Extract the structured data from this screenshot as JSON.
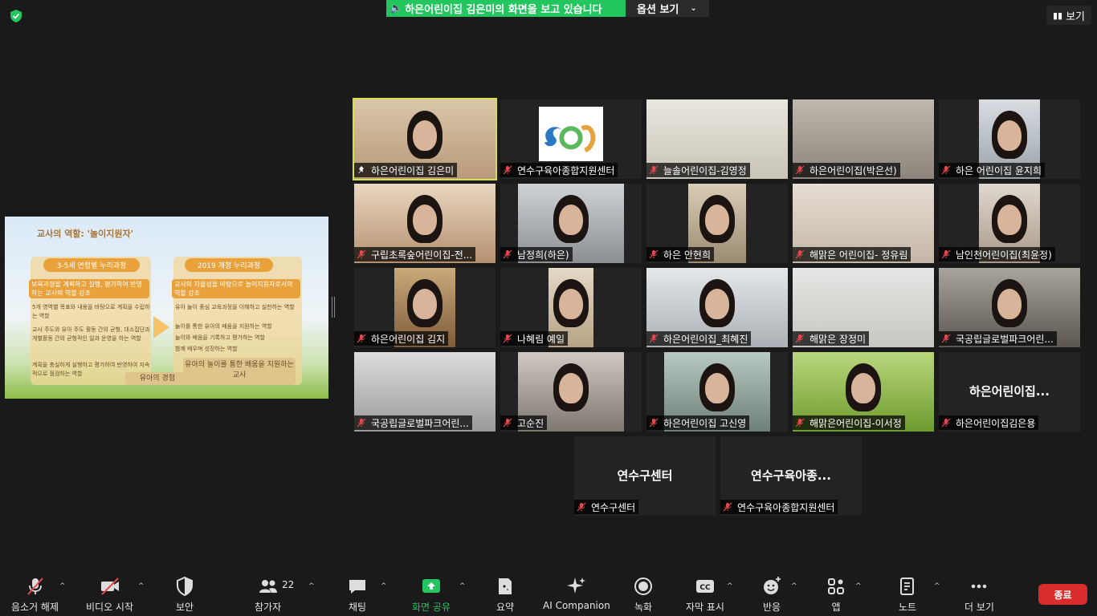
{
  "banner": {
    "sharing_text": "하은어린이집 김은미의 화면을 보고 있습니다",
    "view_options_label": "옵션 보기",
    "view_button_label": "보기"
  },
  "shared_screen": {
    "slide_title": "교사의 역할: '놀이지원자'",
    "left_header": "3-5세 연령별 누리과정",
    "right_header": "2019 개정 누리과정",
    "left_sub": "보육과정을 계획하고 실행, 평가하여 반영하는 교사의 역할 강조",
    "right_sub": "교사의 자율성을 바탕으로 놀이지원자로서의 역할 강조",
    "left_points": [
      "5개 영역별 목표와 내용을 바탕으로 계획을 수립하는 역할",
      "교사 주도와 유아 주도 활동 간의 균형, 대소집단과 개별활동 간의 균형적인 일과 운영을 하는 역할",
      "계획을 충실하게 실행하고 평가하여 반영하여 지속적으로 점검하는 역할"
    ],
    "right_points": [
      "유아 놀이 중심 교육과정을 이해하고 실천하는 역할",
      "놀이를 통한 유아의 배움을 지원하는 역할",
      "놀이와 배움을 기록하고 평가하는 역할",
      "함께 배우며 성장하는 역할"
    ],
    "bottom_left": "유아의 경험",
    "bottom_right": "유아의 놀이를 통한 배움을 지원하는 교사"
  },
  "participants": [
    {
      "name": "하은어린이집 김은미",
      "muted": false,
      "active": true
    },
    {
      "name": "연수구육아종합지원센터",
      "muted": true
    },
    {
      "name": "늘솔어린이집-김영정",
      "muted": true
    },
    {
      "name": "하은어린이집(박은선)",
      "muted": true
    },
    {
      "name": "하은 어린이집 윤지희",
      "muted": true
    },
    {
      "name": "구립초록숲어린이집-전...",
      "muted": true
    },
    {
      "name": "남정희(하은)",
      "muted": true
    },
    {
      "name": "하은 안현희",
      "muted": true
    },
    {
      "name": "해맑은 어린이집- 정유림",
      "muted": true
    },
    {
      "name": "남인천어린이집(최윤정)",
      "muted": true
    },
    {
      "name": "하은어린이집 김지",
      "muted": true
    },
    {
      "name": "나혜림 예일",
      "muted": true
    },
    {
      "name": "하은어린이집_최혜진",
      "muted": true
    },
    {
      "name": "해맑은 장정미",
      "muted": true
    },
    {
      "name": "국공립글로벌파크어린...",
      "muted": true
    },
    {
      "name": "국공립글로벌파크어린...",
      "muted": true
    },
    {
      "name": "고순진",
      "muted": true
    },
    {
      "name": "하은어린이집 고신영",
      "muted": true
    },
    {
      "name": "해맑은어린이집-이서정",
      "muted": true
    },
    {
      "name": "하은어린이집김은용",
      "muted": true,
      "no_video_name": "하은어린이집..."
    },
    {
      "name": "연수구센터",
      "muted": true,
      "no_video_name": "연수구센터"
    },
    {
      "name": "연수구육아종합지원센터",
      "muted": true,
      "no_video_name": "연수구육아종..."
    }
  ],
  "toolbar": {
    "unmute": "음소거 해제",
    "start_video": "비디오 시작",
    "security": "보안",
    "participants": "참가자",
    "participants_count": "22",
    "chat": "채팅",
    "share_screen": "화면 공유",
    "summary": "요약",
    "ai_companion": "AI Companion",
    "record": "녹화",
    "captions": "자막 표시",
    "reactions": "반응",
    "apps": "앱",
    "notes": "노트",
    "more": "더 보기",
    "end": "종료"
  },
  "colors": {
    "share_green": "#22c55e",
    "active_speaker": "#d5e04a",
    "muted_red": "#e5484d",
    "end_red": "#d92d2d"
  }
}
